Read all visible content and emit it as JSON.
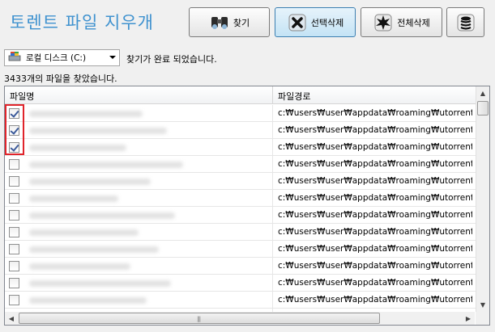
{
  "app": {
    "title": "토렌트 파일 지우개"
  },
  "toolbar": {
    "find_label": "찾기",
    "delete_selected_label": "선택삭제",
    "delete_all_label": "전체삭제",
    "find_icon": "binoculars-icon",
    "delete_selected_icon": "x-mark-icon",
    "delete_all_icon": "splash-icon",
    "extra_icon": "database-icon"
  },
  "drive_select": {
    "value": "로컬 디스크 (C:)",
    "icon": "drive-icon"
  },
  "status": {
    "search_status": "찾기가 완료 되었습니다.",
    "found_count": "3433개의 파일을 찾았습니다."
  },
  "table": {
    "columns": [
      "파일명",
      "파일경로"
    ],
    "rows": [
      {
        "checked": true,
        "path": "c:₩users₩user₩appdata₩roaming₩utorrent₩"
      },
      {
        "checked": true,
        "path": "c:₩users₩user₩appdata₩roaming₩utorrent₩"
      },
      {
        "checked": true,
        "path": "c:₩users₩user₩appdata₩roaming₩utorrent₩"
      },
      {
        "checked": false,
        "path": "c:₩users₩user₩appdata₩roaming₩utorrent₩"
      },
      {
        "checked": false,
        "path": "c:₩users₩user₩appdata₩roaming₩utorrent₩"
      },
      {
        "checked": false,
        "path": "c:₩users₩user₩appdata₩roaming₩utorrent₩"
      },
      {
        "checked": false,
        "path": "c:₩users₩user₩appdata₩roaming₩utorrent₩"
      },
      {
        "checked": false,
        "path": "c:₩users₩user₩appdata₩roaming₩utorrent₩"
      },
      {
        "checked": false,
        "path": "c:₩users₩user₩appdata₩roaming₩utorrent₩"
      },
      {
        "checked": false,
        "path": "c:₩users₩user₩appdata₩roaming₩utorrent₩"
      },
      {
        "checked": false,
        "path": "c:₩users₩user₩appdata₩roaming₩utorrent₩"
      },
      {
        "checked": false,
        "path": "c:₩users₩user₩appdata₩roaming₩utorrent₩"
      },
      {
        "checked": false,
        "path": "c:₩users₩user₩appdata₩roaming₩utorrent₩"
      }
    ]
  },
  "colors": {
    "title": "#3f92cf",
    "highlight_box": "#e0242b",
    "active_button": "#c4e3f5"
  }
}
